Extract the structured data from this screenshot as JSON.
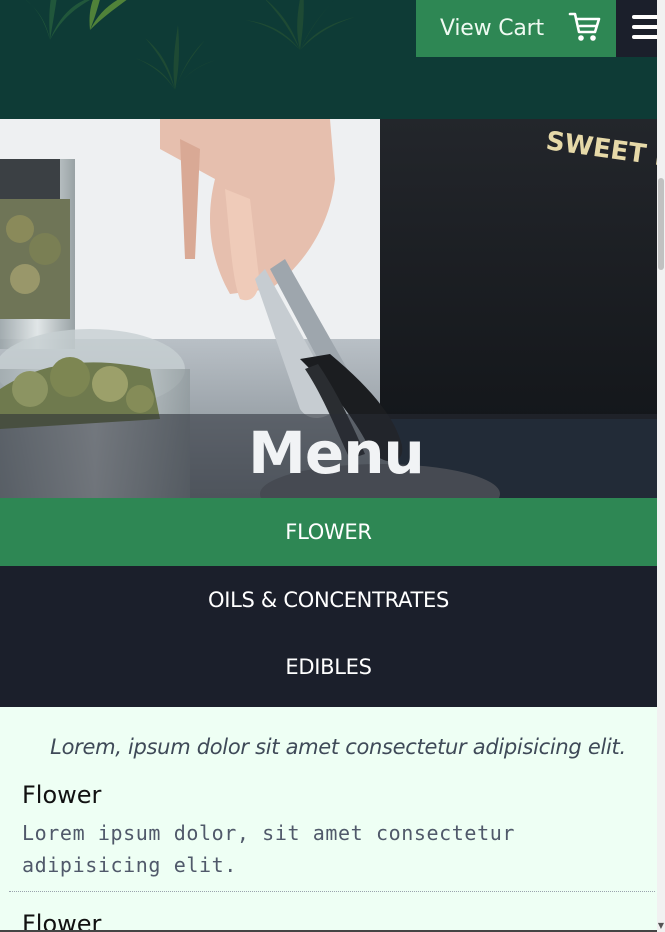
{
  "header": {
    "cart_label": "View Cart",
    "cart_icon": "shopping-cart-icon",
    "menu_icon": "hamburger-menu-icon",
    "background_color": "#0e3b36"
  },
  "hero": {
    "title": "Menu"
  },
  "categories": [
    {
      "label": "FLOWER",
      "active": true
    },
    {
      "label": "OILS & CONCENTRATES",
      "active": false
    },
    {
      "label": "EDIBLES",
      "active": false
    }
  ],
  "content": {
    "intro": "Lorem, ipsum dolor sit amet consectetur adipisicing elit.",
    "items": [
      {
        "title": "Flower",
        "description": "Lorem ipsum dolor, sit amet consectetur adipisicing elit."
      },
      {
        "title": "Flower"
      }
    ]
  },
  "colors": {
    "accent_green": "#2e8754",
    "dark_nav": "#1b1f2b",
    "content_bg": "#eefff4"
  }
}
